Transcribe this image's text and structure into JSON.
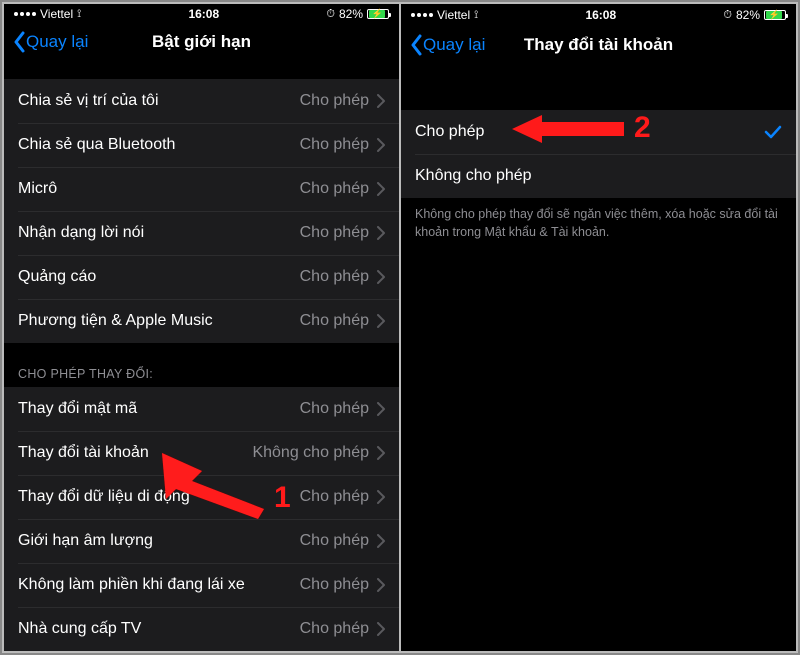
{
  "status": {
    "carrier": "Viettel",
    "time": "16:08",
    "battery_pct": "82%"
  },
  "left_screen": {
    "back_label": "Quay lại",
    "title": "Bật giới hạn",
    "section1": {
      "rows": [
        {
          "label": "Chia sẻ vị trí của tôi",
          "value": "Cho phép"
        },
        {
          "label": "Chia sẻ qua Bluetooth",
          "value": "Cho phép"
        },
        {
          "label": "Micrô",
          "value": "Cho phép"
        },
        {
          "label": "Nhận dạng lời nói",
          "value": "Cho phép"
        },
        {
          "label": "Quảng cáo",
          "value": "Cho phép"
        },
        {
          "label": "Phương tiện & Apple Music",
          "value": "Cho phép"
        }
      ]
    },
    "section2": {
      "header": "CHO PHÉP THAY ĐỔI:",
      "rows": [
        {
          "label": "Thay đổi mật mã",
          "value": "Cho phép"
        },
        {
          "label": "Thay đổi tài khoản",
          "value": "Không cho phép"
        },
        {
          "label": "Thay đổi dữ liệu di động",
          "value": "Cho phép"
        },
        {
          "label": "Giới hạn âm lượng",
          "value": "Cho phép"
        },
        {
          "label": "Không làm phiền khi đang lái xe",
          "value": "Cho phép"
        },
        {
          "label": "Nhà cung cấp TV",
          "value": "Cho phép"
        }
      ]
    },
    "annotation_num": "1"
  },
  "right_screen": {
    "back_label": "Quay lại",
    "title": "Thay đổi tài khoản",
    "rows": [
      {
        "label": "Cho phép",
        "checked": true
      },
      {
        "label": "Không cho phép",
        "checked": false
      }
    ],
    "footer": "Không cho phép thay đổi sẽ ngăn việc thêm, xóa hoặc sửa đổi tài khoản trong Mật khẩu & Tài khoản.",
    "annotation_num": "2"
  }
}
